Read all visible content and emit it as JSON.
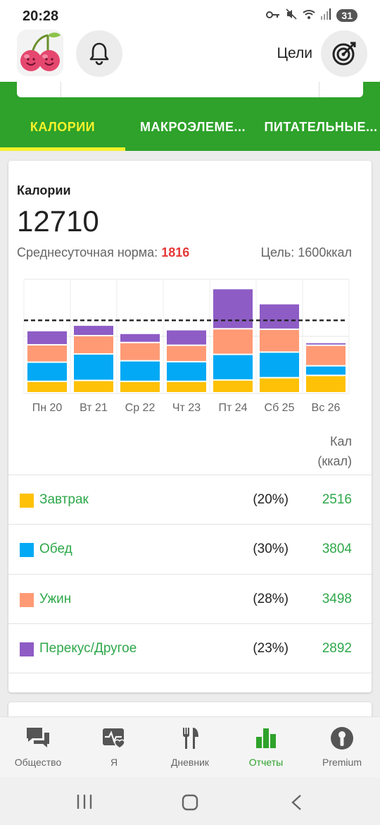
{
  "status": {
    "time": "20:28",
    "battery": "31"
  },
  "header": {
    "goals_label": "Цели"
  },
  "tabs": [
    {
      "label": "КАЛОРИИ",
      "active": true
    },
    {
      "label": "МАКРОЭЛЕМЕ...",
      "active": false
    },
    {
      "label": "ПИТАТЕЛЬНЫЕ...",
      "active": false
    }
  ],
  "summary": {
    "title": "Калории",
    "total": "12710",
    "avg_label": "Среднесуточная норма:",
    "avg_value": "1816",
    "goal_text": "Цель: 1600ккал"
  },
  "chart_data": {
    "type": "bar",
    "stacked": true,
    "categories": [
      "Пн 20",
      "Вт 21",
      "Ср 22",
      "Чт 23",
      "Пт 24",
      "Сб 25",
      "Вс 26"
    ],
    "series": [
      {
        "name": "Завтрак",
        "color": "#ffc107",
        "values": [
          250,
          270,
          250,
          250,
          280,
          330,
          380
        ]
      },
      {
        "name": "Обед",
        "color": "#03a9f4",
        "values": [
          420,
          580,
          450,
          430,
          560,
          560,
          210
        ]
      },
      {
        "name": "Ужин",
        "color": "#ff9a75",
        "values": [
          380,
          400,
          400,
          360,
          560,
          500,
          450
        ]
      },
      {
        "name": "Перекус/Другое",
        "color": "#8e5cc5",
        "values": [
          310,
          230,
          200,
          340,
          880,
          560,
          60
        ]
      }
    ],
    "goal_line": 1600,
    "ylim": [
      0,
      2500
    ],
    "grid": true
  },
  "table": {
    "header_line1": "Кал",
    "header_line2": "(ккал)",
    "rows": [
      {
        "name": "Завтрак",
        "pct": "(20%)",
        "value": "2516",
        "color": "#ffc107"
      },
      {
        "name": "Обед",
        "pct": "(30%)",
        "value": "3804",
        "color": "#03a9f4"
      },
      {
        "name": "Ужин",
        "pct": "(28%)",
        "value": "3498",
        "color": "#ff9a75"
      },
      {
        "name": "Перекус/Другое",
        "pct": "(23%)",
        "value": "2892",
        "color": "#8e5cc5"
      }
    ]
  },
  "nav": [
    {
      "label": "Общество",
      "icon": "community-icon",
      "active": false
    },
    {
      "label": "Я",
      "icon": "health-heart-icon",
      "active": false
    },
    {
      "label": "Дневник",
      "icon": "fork-knife-icon",
      "active": false
    },
    {
      "label": "Отчеты",
      "icon": "bar-chart-icon",
      "active": true
    },
    {
      "label": "Premium",
      "icon": "premium-icon",
      "active": false
    }
  ]
}
